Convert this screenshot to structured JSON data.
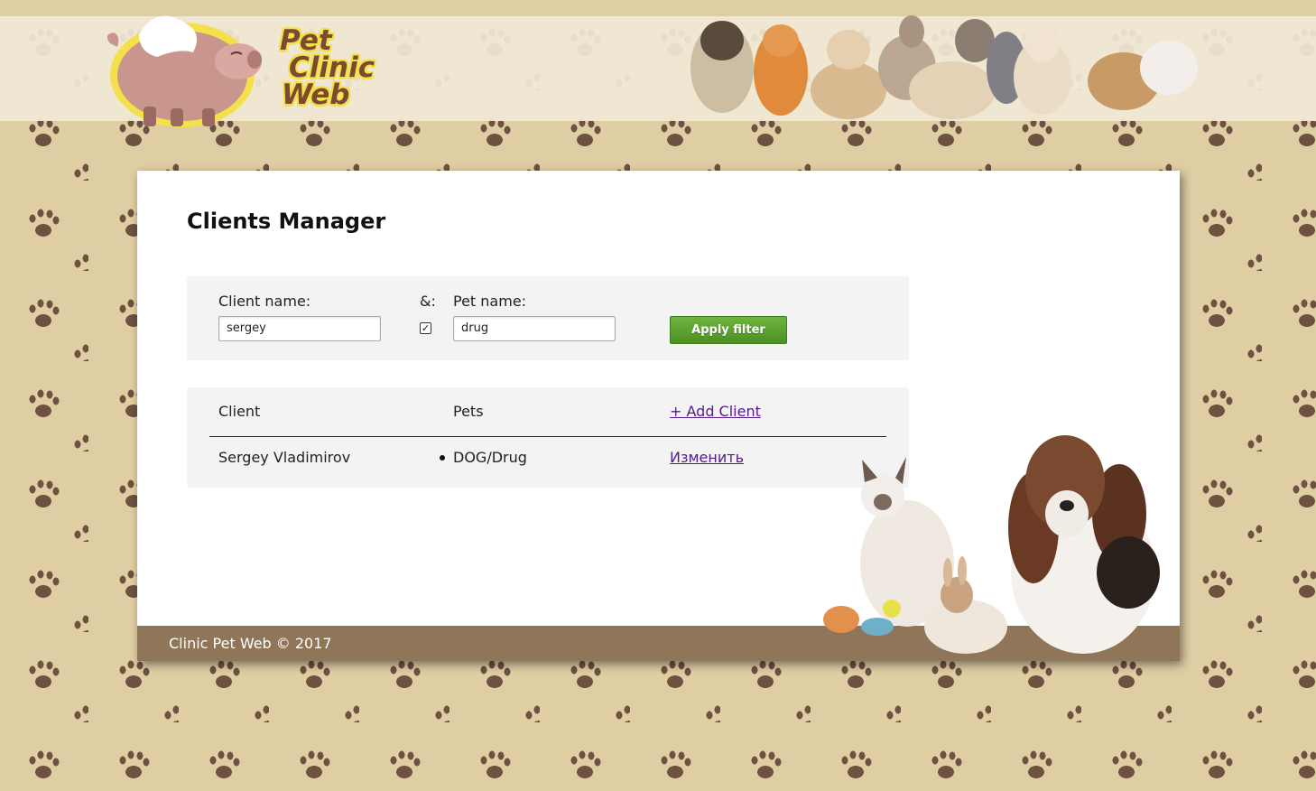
{
  "header": {
    "logo": {
      "line1": "Pet",
      "line2": "Clinic",
      "line3": "Web"
    }
  },
  "page": {
    "title": "Clients Manager"
  },
  "filter": {
    "client_label": "Client name:",
    "client_value": "sergey",
    "and_label": "&:",
    "and_checked": true,
    "pet_label": "Pet name:",
    "pet_value": "drug",
    "apply_label": "Apply filter"
  },
  "table": {
    "headers": {
      "client": "Client",
      "pets": "Pets",
      "add_link": "+ Add Client"
    },
    "rows": [
      {
        "client": "Sergey Vladimirov",
        "pets": [
          "DOG/Drug"
        ],
        "action": "Изменить"
      }
    ]
  },
  "footer": {
    "text": "Clinic Pet Web © 2017"
  },
  "colors": {
    "background": "#dfcda3",
    "paw": "#6e5140",
    "footer": "#8f7659",
    "button": "#5aa02f",
    "link": "#551a8b"
  }
}
